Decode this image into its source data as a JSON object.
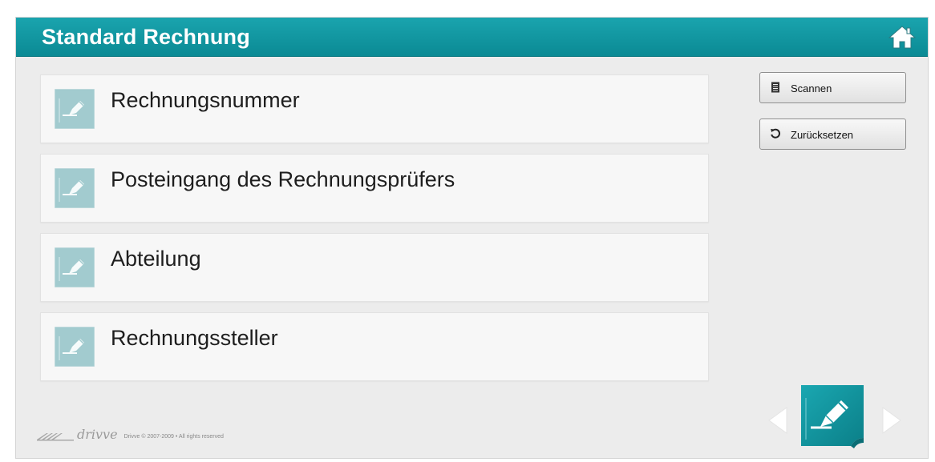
{
  "header": {
    "title": "Standard Rechnung",
    "home_icon": "home-icon"
  },
  "fields": [
    {
      "label": "Rechnungsnummer",
      "icon": "edit-field-icon"
    },
    {
      "label": "Posteingang des Rechnungsprüfers",
      "icon": "edit-field-icon"
    },
    {
      "label": "Abteilung",
      "icon": "edit-field-icon"
    },
    {
      "label": "Rechnungssteller",
      "icon": "edit-field-icon"
    }
  ],
  "actions": {
    "scan_label": "Scannen",
    "scan_icon": "document-icon",
    "reset_label": "Zurücksetzen",
    "reset_icon": "reset-icon"
  },
  "footer": {
    "brand": "drivve",
    "copyright": "Drivve © 2007-2009 • All rights reserved"
  },
  "navigation": {
    "prev_icon": "arrow-left-icon",
    "current_icon": "edit-document-icon",
    "next_icon": "arrow-right-icon"
  },
  "colors": {
    "header": "#0f95a0",
    "background": "#ececec",
    "field": "#f7f7f7",
    "field_icon": "#9fc9cd"
  }
}
